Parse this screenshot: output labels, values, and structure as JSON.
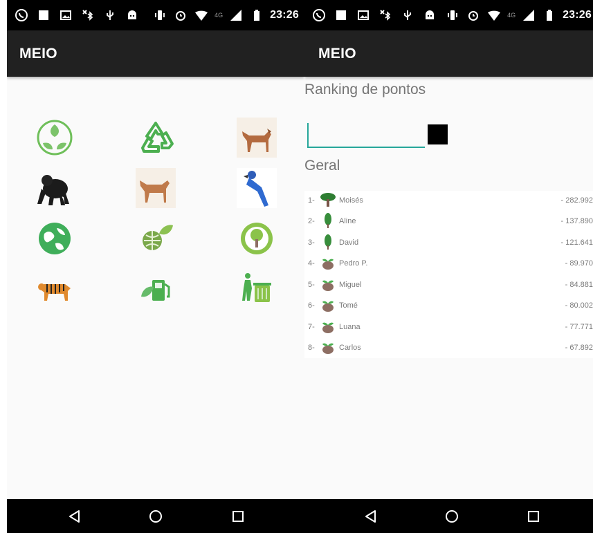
{
  "status_bar": {
    "time": "23:26",
    "network_label": "4G",
    "left_icons": [
      "whatsapp-icon",
      "square-notification-icon",
      "image-icon",
      "bluetooth-x-icon",
      "usb-icon",
      "android-icon"
    ],
    "right_icons": [
      "vibrate-icon",
      "alarm-icon",
      "wifi-icon",
      "signal-icon",
      "battery-icon"
    ]
  },
  "left_screen": {
    "app_title": "MEIO",
    "grid_icons": [
      "leaves-circle-icon",
      "recycle-arrows-icon",
      "horse-icon",
      "gorilla-icon",
      "horse-icon",
      "macaw-icon",
      "globe-icon",
      "globe-leaf-icon",
      "tree-circle-icon",
      "tiger-icon",
      "fuel-leaf-icon",
      "trash-recycle-icon"
    ]
  },
  "right_screen": {
    "app_title": "MEIO",
    "ranking_title": "Ranking de pontos",
    "search_value": "",
    "general_title": "Geral",
    "ranking": [
      {
        "position": "1-",
        "name": "Moisés",
        "score": "- 282.992",
        "icon": "big-tree-icon"
      },
      {
        "position": "2-",
        "name": "Aline",
        "score": "- 137.890",
        "icon": "small-tree-icon"
      },
      {
        "position": "3-",
        "name": "David",
        "score": "- 121.641",
        "icon": "small-tree-icon"
      },
      {
        "position": "4-",
        "name": "Pedro P.",
        "score": "- 89.970",
        "icon": "seed-sprout-icon"
      },
      {
        "position": "5-",
        "name": "Miguel",
        "score": "- 84.881",
        "icon": "seed-sprout-icon"
      },
      {
        "position": "6-",
        "name": "Tomé",
        "score": "- 80.002",
        "icon": "seed-sprout-icon"
      },
      {
        "position": "7-",
        "name": "Luana",
        "score": "- 77.771",
        "icon": "seed-sprout-icon"
      },
      {
        "position": "8-",
        "name": "Carlos",
        "score": "- 67.892",
        "icon": "seed-sprout-icon"
      }
    ]
  },
  "nav_bar": {
    "icons": [
      "back-icon",
      "home-icon",
      "recents-icon"
    ]
  },
  "colors": {
    "appbar": "#212121",
    "status_bar": "#000000",
    "accent": "#26a69a",
    "eco_green": "#4caf50",
    "rank_text": "#7b7b7b"
  }
}
